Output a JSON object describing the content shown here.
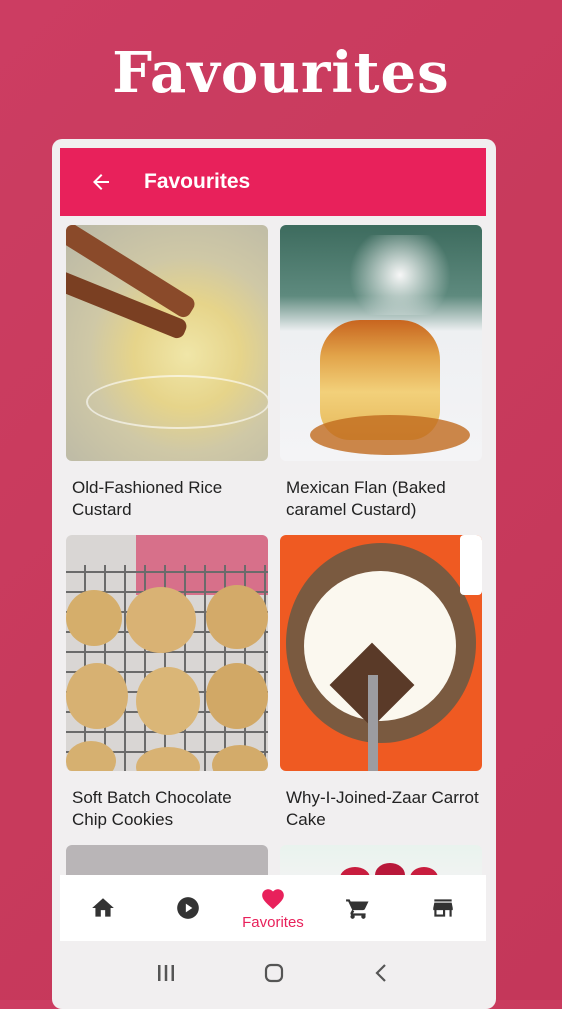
{
  "promo": {
    "title": "Favourites"
  },
  "appbar": {
    "title": "Favourites"
  },
  "recipes": [
    {
      "title": "Old-Fashioned Rice Custard"
    },
    {
      "title": "Mexican Flan (Baked caramel Custard)"
    },
    {
      "title": "Soft Batch Chocolate Chip Cookies"
    },
    {
      "title": "Why-I-Joined-Zaar Carrot Cake"
    }
  ],
  "bottom_nav": {
    "items": [
      {
        "icon": "home-icon"
      },
      {
        "icon": "play-icon"
      },
      {
        "icon": "heart-icon",
        "label": "Favorites",
        "active": true
      },
      {
        "icon": "cart-icon"
      },
      {
        "icon": "store-icon"
      }
    ]
  },
  "colors": {
    "accent": "#e8215b",
    "background": "#c83a5c"
  }
}
